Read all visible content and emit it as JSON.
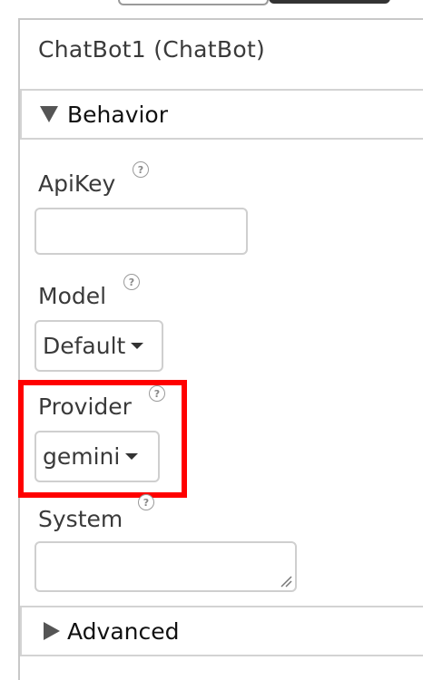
{
  "component": {
    "title": "ChatBot1 (ChatBot)"
  },
  "sections": {
    "behavior": {
      "label": "Behavior",
      "expanded": true
    },
    "advanced": {
      "label": "Advanced",
      "expanded": false
    }
  },
  "properties": {
    "apikey": {
      "label": "ApiKey",
      "value": "",
      "help_icon": "?"
    },
    "model": {
      "label": "Model",
      "selected": "Default",
      "help_icon": "?"
    },
    "provider": {
      "label": "Provider",
      "selected": "gemini",
      "help_icon": "?",
      "highlight_color": "#ff0000"
    },
    "system": {
      "label": "System",
      "value": "",
      "help_icon": "?"
    }
  },
  "icons": {
    "expand": "triangle-down-icon",
    "collapse": "triangle-right-icon",
    "help": "question-circle-icon",
    "dropdown": "caret-down-icon"
  }
}
